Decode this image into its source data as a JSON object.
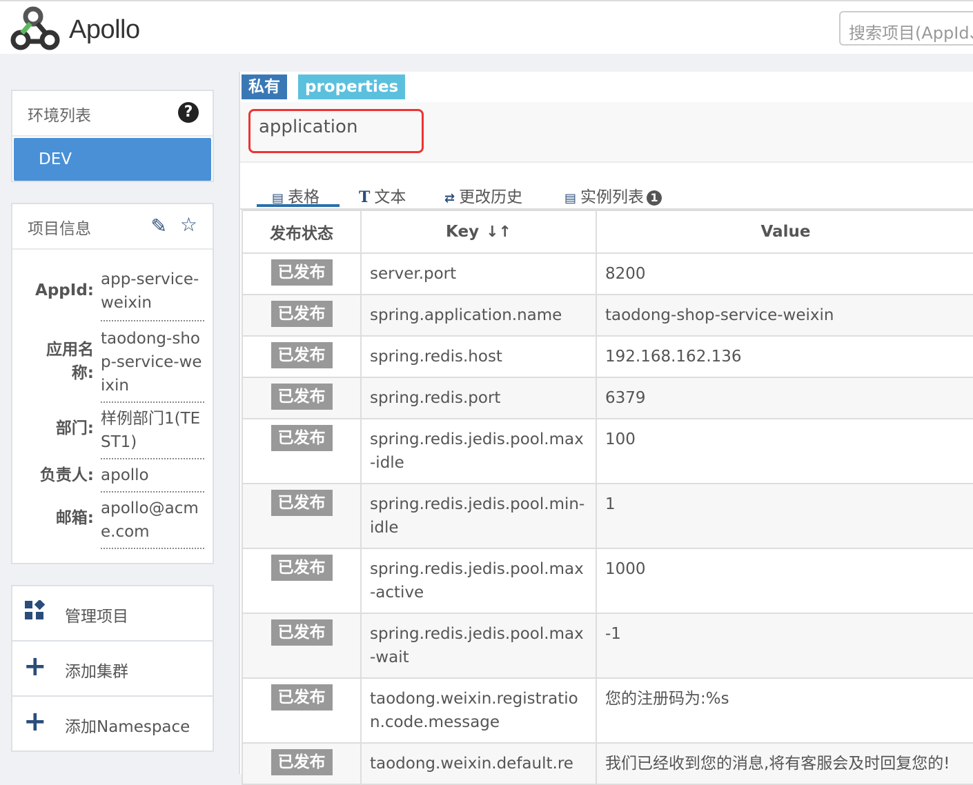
{
  "header": {
    "brand": "Apollo",
    "search_placeholder": "搜索项目(AppId、项目名)"
  },
  "env_panel": {
    "title": "环境列表",
    "help_icon": "question-circle-icon",
    "envs": [
      "DEV"
    ]
  },
  "project_panel": {
    "title": "项目信息",
    "rows": [
      {
        "label": "AppId:",
        "value": "app-service-weixin"
      },
      {
        "label": "应用名称:",
        "value": "taodong-shop-service-weixin"
      },
      {
        "label": "部门:",
        "value": "样例部门1(TEST1)"
      },
      {
        "label": "负责人:",
        "value": "apollo"
      },
      {
        "label": "邮箱:",
        "value": "apollo@acme.com"
      }
    ]
  },
  "actions": [
    {
      "label": "管理项目",
      "icon": "dashboard-icon"
    },
    {
      "label": "添加集群",
      "icon": "plus-icon"
    },
    {
      "label": "添加Namespace",
      "icon": "plus-icon"
    }
  ],
  "namespace": {
    "tag_scope": "私有",
    "tag_format": "properties",
    "name": "application"
  },
  "tabs": [
    {
      "label": "表格",
      "icon": "table-icon"
    },
    {
      "label": "文本",
      "icon": "text-icon"
    },
    {
      "label": "更改历史",
      "icon": "history-icon"
    },
    {
      "label": "实例列表",
      "icon": "instance-list-icon",
      "badge": "1"
    }
  ],
  "table": {
    "headers": {
      "status": "发布状态",
      "key": "Key",
      "value": "Value"
    },
    "rows": [
      {
        "status": "已发布",
        "key": "server.port",
        "value": "8200"
      },
      {
        "status": "已发布",
        "key": "spring.application.name",
        "value": "taodong-shop-service-weixin"
      },
      {
        "status": "已发布",
        "key": "spring.redis.host",
        "value": "192.168.162.136"
      },
      {
        "status": "已发布",
        "key": "spring.redis.port",
        "value": "6379"
      },
      {
        "status": "已发布",
        "key": "spring.redis.jedis.pool.max-idle",
        "value": "100"
      },
      {
        "status": "已发布",
        "key": "spring.redis.jedis.pool.min-idle",
        "value": "1"
      },
      {
        "status": "已发布",
        "key": "spring.redis.jedis.pool.max-active",
        "value": "1000"
      },
      {
        "status": "已发布",
        "key": "spring.redis.jedis.pool.max-wait",
        "value": "-1"
      },
      {
        "status": "已发布",
        "key": "taodong.weixin.registration.code.message",
        "value": "您的注册码为:%s"
      },
      {
        "status": "已发布",
        "key": "taodong.weixin.default.re",
        "value": "我们已经收到您的消息,将有客服会及时回复您的!"
      }
    ]
  }
}
